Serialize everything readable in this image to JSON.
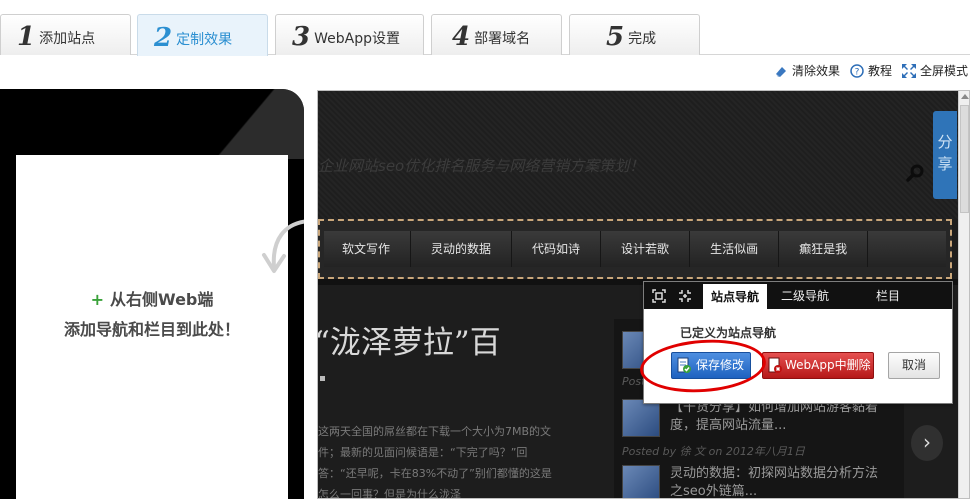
{
  "steps": [
    {
      "num": "1",
      "label": "添加站点"
    },
    {
      "num": "2",
      "label": "定制效果"
    },
    {
      "num": "3",
      "label": "WebApp设置"
    },
    {
      "num": "4",
      "label": "部署域名"
    },
    {
      "num": "5",
      "label": "完成"
    }
  ],
  "active_step": 2,
  "toolbar": {
    "clear_label": "清除效果",
    "tutorial_label": "教程",
    "fullscreen_label": "全屏模式"
  },
  "phone": {
    "hint_line1": "从右侧Web端",
    "hint_line2": "添加导航和栏目到此处！"
  },
  "preview": {
    "slogan": "企业网站seo优化排名服务与网络营销方案策划！",
    "share_label": "分享",
    "nav_items": [
      "软文写作",
      "灵动的数据",
      "代码如诗",
      "设计若歌",
      "生活似画",
      "癫狂是我"
    ],
    "headline": "“泷泽萝拉”百",
    "body_text": "这两天全国的屌丝都在下载一个大小为7MB的文件；最新的见面问候语是：“下完了吗？”回答：“还早呢，卡在83%不动了”别们都懂的这是怎么一回事？但是为什么泷泽",
    "side_posts": [
      {
        "title": "【干货分享】如何增加网站游客黏着度，提高网站流量..."
      },
      {
        "title": "灵动的数据：初探网站数据分析方法之seo外链篇..."
      }
    ],
    "posted_text_1": "Post",
    "posted_text_2": "Posted by 徐 文 on 2012年八月1日"
  },
  "popup": {
    "tabs": [
      "站点导航",
      "二级导航",
      "栏目"
    ],
    "active_tab": "站点导航",
    "message": "已定义为站点导航",
    "save_label": "保存修改",
    "delete_label": "WebApp中删除",
    "cancel_label": "取消"
  },
  "colors": {
    "accent": "#2b8fd1",
    "save_button": "#2f74d0",
    "delete_button": "#d22b2b",
    "highlight_circle": "#e00000",
    "nav_dashed_border": "#c9a67a"
  }
}
